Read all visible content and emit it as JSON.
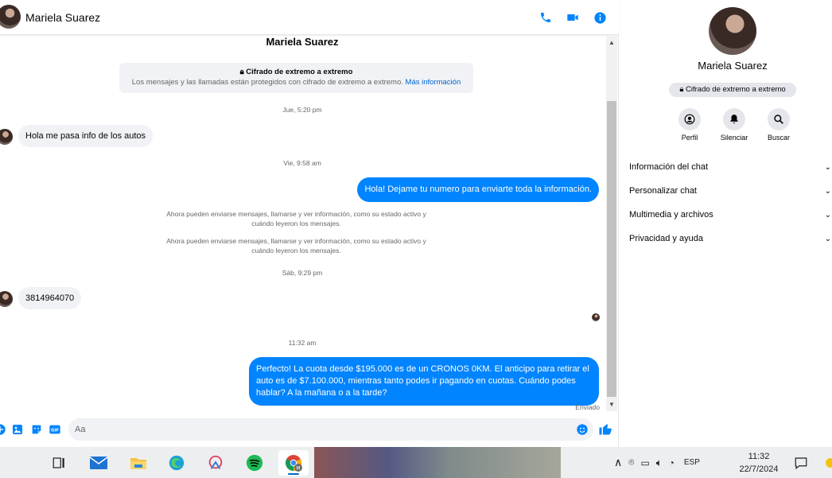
{
  "chat": {
    "contact_name": "Mariela Suarez",
    "header_icons": [
      "phone-icon",
      "video-icon",
      "info-icon"
    ],
    "encryption": {
      "title": "Cifrado de extremo a extremo",
      "desc": "Los mensajes y las llamadas están protegidos con cifrado de extremo a extremo.",
      "link": "Más información"
    },
    "ts1": "Jue, 5:20 pm",
    "msg1": "Hola me pasa info de los autos",
    "ts2": "Vie, 9:58 am",
    "msg2": "Hola! Dejame tu numero  para enviarte toda la información.",
    "sys1": "Ahora pueden enviarse mensajes, llamarse y ver información, como su estado activo y cuándo leyeron los mensajes.",
    "sys2": "Ahora pueden enviarse mensajes, llamarse y ver información, como su estado activo y cuándo leyeron los mensajes.",
    "ts3": "Sáb, 9:29 pm",
    "msg3": "3814964070",
    "ts4": "11:32 am",
    "msg4": "Perfecto! La cuota desde $195.000 es de un CRONOS 0KM. El anticipo para retirar el auto es de $7.100.000, mientras tanto podes ir pagando en cuotas. Cuándo podes hablar? A la mañana o a la tarde?",
    "status": "Enviado",
    "input_placeholder": "Aa"
  },
  "info": {
    "name": "Mariela Suarez",
    "badge": "Cifrado de extremo a extremo",
    "actions": [
      "Perfil",
      "Silenciar",
      "Buscar"
    ],
    "sections": [
      "Información del chat",
      "Personalizar chat",
      "Multimedia y archivos",
      "Privacidad y ayuda"
    ]
  },
  "taskbar": {
    "lang": "ESP",
    "time": "11:32",
    "date": "22/7/2024"
  },
  "colors": {
    "accent": "#0084ff",
    "link": "#0064d1",
    "bubble_in": "#f0f2f5"
  }
}
